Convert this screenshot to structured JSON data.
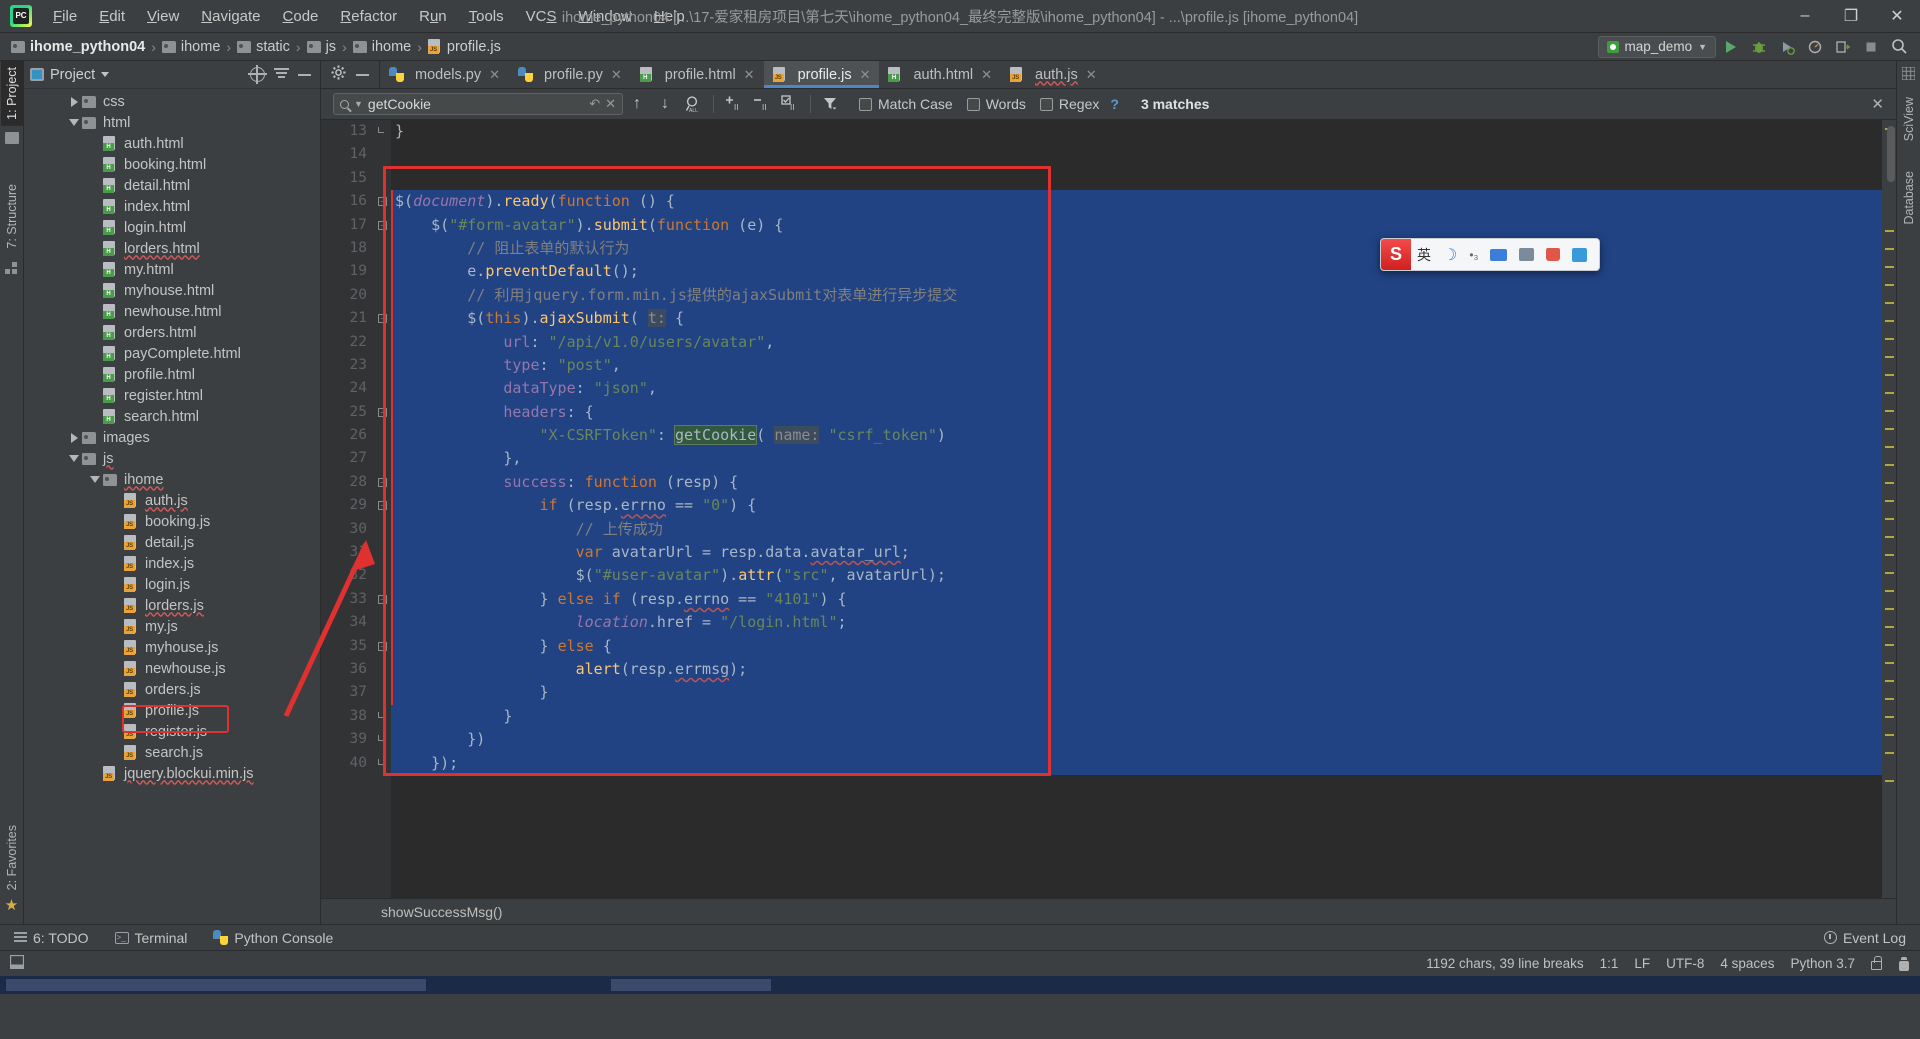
{
  "window": {
    "title": "ihome_python04 [...\\17-爱家租房项目\\第七天\\ihome_python04_最终完整版\\ihome_python04] - ...\\profile.js [ihome_python04]",
    "minimize": "–",
    "maximize": "❐",
    "close": "✕"
  },
  "menu": [
    {
      "label": "File"
    },
    {
      "label": "Edit"
    },
    {
      "label": "View"
    },
    {
      "label": "Navigate"
    },
    {
      "label": "Code"
    },
    {
      "label": "Refactor"
    },
    {
      "label": "Run"
    },
    {
      "label": "Tools"
    },
    {
      "label": "VCS"
    },
    {
      "label": "Window"
    },
    {
      "label": "Help"
    }
  ],
  "breadcrumb": [
    {
      "label": "ihome_python04",
      "icon": "folder-icon",
      "bold": true
    },
    {
      "label": "ihome",
      "icon": "folder-icon",
      "bold": false
    },
    {
      "label": "static",
      "icon": "folder-icon",
      "bold": false
    },
    {
      "label": "js",
      "icon": "folder-icon",
      "bold": false
    },
    {
      "label": "ihome",
      "icon": "folder-icon",
      "bold": false
    },
    {
      "label": "profile.js",
      "icon": "js-file-icon",
      "bold": false
    }
  ],
  "run_config": {
    "name": "map_demo",
    "run_label": "Run",
    "debug_label": "Debug",
    "coverage_label": "Run with Coverage",
    "profile_label": "Profile",
    "stop_label": "Stop",
    "search_label": "Search Everywhere"
  },
  "left_strip": [
    {
      "label": "1: Project",
      "active": true
    },
    {
      "label": "7: Structure",
      "active": false
    },
    {
      "label": "2: Favorites",
      "active": false
    }
  ],
  "right_strip": [
    {
      "label": "SciView"
    },
    {
      "label": "Database"
    }
  ],
  "project_panel": {
    "title": "Project",
    "locate_icon": "target-icon",
    "collapse_icon": "collapse-all-icon",
    "hide_icon": "hide-panel-icon",
    "tree": [
      {
        "label": "css",
        "depth": 2,
        "type": "folder",
        "twisty": "right",
        "squiggle": false
      },
      {
        "label": "html",
        "depth": 2,
        "type": "folder",
        "twisty": "down",
        "squiggle": false
      },
      {
        "label": "auth.html",
        "depth": 3,
        "type": "html",
        "twisty": "none",
        "squiggle": false
      },
      {
        "label": "booking.html",
        "depth": 3,
        "type": "html",
        "twisty": "none",
        "squiggle": false
      },
      {
        "label": "detail.html",
        "depth": 3,
        "type": "html",
        "twisty": "none",
        "squiggle": false
      },
      {
        "label": "index.html",
        "depth": 3,
        "type": "html",
        "twisty": "none",
        "squiggle": false
      },
      {
        "label": "login.html",
        "depth": 3,
        "type": "html",
        "twisty": "none",
        "squiggle": false
      },
      {
        "label": "lorders.html",
        "depth": 3,
        "type": "html",
        "twisty": "none",
        "squiggle": true
      },
      {
        "label": "my.html",
        "depth": 3,
        "type": "html",
        "twisty": "none",
        "squiggle": false
      },
      {
        "label": "myhouse.html",
        "depth": 3,
        "type": "html",
        "twisty": "none",
        "squiggle": false
      },
      {
        "label": "newhouse.html",
        "depth": 3,
        "type": "html",
        "twisty": "none",
        "squiggle": false
      },
      {
        "label": "orders.html",
        "depth": 3,
        "type": "html",
        "twisty": "none",
        "squiggle": false
      },
      {
        "label": "payComplete.html",
        "depth": 3,
        "type": "html",
        "twisty": "none",
        "squiggle": false
      },
      {
        "label": "profile.html",
        "depth": 3,
        "type": "html",
        "twisty": "none",
        "squiggle": false
      },
      {
        "label": "register.html",
        "depth": 3,
        "type": "html",
        "twisty": "none",
        "squiggle": false
      },
      {
        "label": "search.html",
        "depth": 3,
        "type": "html",
        "twisty": "none",
        "squiggle": false
      },
      {
        "label": "images",
        "depth": 2,
        "type": "folder",
        "twisty": "right",
        "squiggle": false
      },
      {
        "label": "js",
        "depth": 2,
        "type": "folder",
        "twisty": "down",
        "squiggle": true
      },
      {
        "label": "ihome",
        "depth": 3,
        "type": "folder",
        "twisty": "down",
        "squiggle": true
      },
      {
        "label": "auth.js",
        "depth": 4,
        "type": "js",
        "twisty": "none",
        "squiggle": true
      },
      {
        "label": "booking.js",
        "depth": 4,
        "type": "js",
        "twisty": "none",
        "squiggle": false
      },
      {
        "label": "detail.js",
        "depth": 4,
        "type": "js",
        "twisty": "none",
        "squiggle": false
      },
      {
        "label": "index.js",
        "depth": 4,
        "type": "js",
        "twisty": "none",
        "squiggle": false
      },
      {
        "label": "login.js",
        "depth": 4,
        "type": "js",
        "twisty": "none",
        "squiggle": false
      },
      {
        "label": "lorders.js",
        "depth": 4,
        "type": "js",
        "twisty": "none",
        "squiggle": true
      },
      {
        "label": "my.js",
        "depth": 4,
        "type": "js",
        "twisty": "none",
        "squiggle": false
      },
      {
        "label": "myhouse.js",
        "depth": 4,
        "type": "js",
        "twisty": "none",
        "squiggle": false
      },
      {
        "label": "newhouse.js",
        "depth": 4,
        "type": "js",
        "twisty": "none",
        "squiggle": false
      },
      {
        "label": "orders.js",
        "depth": 4,
        "type": "js",
        "twisty": "none",
        "squiggle": false
      },
      {
        "label": "profile.js",
        "depth": 4,
        "type": "js",
        "twisty": "none",
        "squiggle": false,
        "highlighted": true
      },
      {
        "label": "register.js",
        "depth": 4,
        "type": "js",
        "twisty": "none",
        "squiggle": false
      },
      {
        "label": "search.js",
        "depth": 4,
        "type": "js",
        "twisty": "none",
        "squiggle": false
      },
      {
        "label": "jquery.blockui.min.js",
        "depth": 3,
        "type": "jsmin",
        "twisty": "none",
        "squiggle": true
      }
    ]
  },
  "editor_tabs": [
    {
      "label": "models.py",
      "icon": "python-file-icon",
      "active": false
    },
    {
      "label": "profile.py",
      "icon": "python-file-icon",
      "active": false
    },
    {
      "label": "profile.html",
      "icon": "html-file-icon",
      "active": false
    },
    {
      "label": "profile.js",
      "icon": "js-file-icon",
      "active": true
    },
    {
      "label": "auth.html",
      "icon": "html-file-icon",
      "active": false
    },
    {
      "label": "auth.js",
      "icon": "js-file-icon",
      "active": false
    }
  ],
  "find_bar": {
    "query": "getCookie",
    "placeholder": "Search",
    "prev_label": "Previous Occurrence",
    "next_label": "Next Occurrence",
    "find_all_label": "Find All",
    "select_all_label": "Select All Occurrences",
    "add_line_label": "Add Line Selection",
    "remove_line_label": "Remove Line Selection",
    "filter_label": "Filter Search Results",
    "match_case": "Match Case",
    "words": "Words",
    "regex": "Regex",
    "help": "?",
    "matches": "3 matches",
    "close": "✕"
  },
  "code": {
    "first_line": 13,
    "lines": [
      {
        "n": 13,
        "fold": "end",
        "segments": [
          {
            "t": "}",
            "c": "par"
          }
        ]
      },
      {
        "n": 14,
        "fold": "",
        "segments": []
      },
      {
        "n": 15,
        "fold": "",
        "segments": []
      },
      {
        "n": 16,
        "fold": "start",
        "segments": [
          {
            "t": "$",
            "c": "par"
          },
          {
            "t": "(",
            "c": "par"
          },
          {
            "t": "document",
            "c": "doc"
          },
          {
            "t": ").",
            "c": "par"
          },
          {
            "t": "ready",
            "c": "fn"
          },
          {
            "t": "(",
            "c": "par"
          },
          {
            "t": "function",
            "c": "kw"
          },
          {
            "t": " () {",
            "c": "par"
          }
        ]
      },
      {
        "n": 17,
        "fold": "start",
        "segments": [
          {
            "t": "    $(",
            "c": "par"
          },
          {
            "t": "\"#form-avatar\"",
            "c": "str"
          },
          {
            "t": ").",
            "c": "par"
          },
          {
            "t": "submit",
            "c": "fn"
          },
          {
            "t": "(",
            "c": "par"
          },
          {
            "t": "function",
            "c": "kw"
          },
          {
            "t": " (e) {",
            "c": "par"
          }
        ]
      },
      {
        "n": 18,
        "fold": "",
        "segments": [
          {
            "t": "        // 阻止表单的默认行为",
            "c": "cmt"
          }
        ]
      },
      {
        "n": 19,
        "fold": "",
        "segments": [
          {
            "t": "        e.",
            "c": "par"
          },
          {
            "t": "preventDefault",
            "c": "fn"
          },
          {
            "t": "();",
            "c": "par"
          }
        ]
      },
      {
        "n": 20,
        "fold": "",
        "segments": [
          {
            "t": "        // 利用jquery.form.min.js提供的ajaxSubmit对表单进行异步提交",
            "c": "cmt"
          }
        ]
      },
      {
        "n": 21,
        "fold": "start",
        "segments": [
          {
            "t": "        $(",
            "c": "par"
          },
          {
            "t": "this",
            "c": "kw"
          },
          {
            "t": ").",
            "c": "par"
          },
          {
            "t": "ajaxSubmit",
            "c": "fn"
          },
          {
            "t": "( ",
            "c": "par"
          },
          {
            "t": "t:",
            "c": "hint"
          },
          {
            "t": " {",
            "c": "par"
          }
        ]
      },
      {
        "n": 22,
        "fold": "",
        "segments": [
          {
            "t": "            url",
            "c": "prop"
          },
          {
            "t": ": ",
            "c": "par"
          },
          {
            "t": "\"/api/v1.0/users/avatar\"",
            "c": "str"
          },
          {
            "t": ",",
            "c": "par"
          }
        ]
      },
      {
        "n": 23,
        "fold": "",
        "segments": [
          {
            "t": "            type",
            "c": "prop"
          },
          {
            "t": ": ",
            "c": "par"
          },
          {
            "t": "\"post\"",
            "c": "str"
          },
          {
            "t": ",",
            "c": "par"
          }
        ]
      },
      {
        "n": 24,
        "fold": "",
        "segments": [
          {
            "t": "            dataType",
            "c": "prop"
          },
          {
            "t": ": ",
            "c": "par"
          },
          {
            "t": "\"json\"",
            "c": "str"
          },
          {
            "t": ",",
            "c": "par"
          }
        ]
      },
      {
        "n": 25,
        "fold": "start",
        "segments": [
          {
            "t": "            headers",
            "c": "prop"
          },
          {
            "t": ": {",
            "c": "par"
          }
        ]
      },
      {
        "n": 26,
        "fold": "",
        "segments": [
          {
            "t": "                ",
            "c": "par"
          },
          {
            "t": "\"X-CSRFToken\"",
            "c": "str"
          },
          {
            "t": ": ",
            "c": "par"
          },
          {
            "t": "getCookie",
            "c": "occ"
          },
          {
            "t": "( ",
            "c": "par"
          },
          {
            "t": "name:",
            "c": "hint"
          },
          {
            "t": " ",
            "c": "par"
          },
          {
            "t": "\"csrf_token\"",
            "c": "str"
          },
          {
            "t": ")",
            "c": "par"
          }
        ]
      },
      {
        "n": 27,
        "fold": "",
        "segments": [
          {
            "t": "            },",
            "c": "par"
          }
        ]
      },
      {
        "n": 28,
        "fold": "start",
        "segments": [
          {
            "t": "            success",
            "c": "prop"
          },
          {
            "t": ": ",
            "c": "par"
          },
          {
            "t": "function",
            "c": "kw"
          },
          {
            "t": " (resp) {",
            "c": "par"
          }
        ]
      },
      {
        "n": 29,
        "fold": "start",
        "segments": [
          {
            "t": "                ",
            "c": "par"
          },
          {
            "t": "if",
            "c": "kw"
          },
          {
            "t": " (resp.",
            "c": "par"
          },
          {
            "t": "errno",
            "c": "err"
          },
          {
            "t": " == ",
            "c": "par"
          },
          {
            "t": "\"0\"",
            "c": "str"
          },
          {
            "t": ") {",
            "c": "par"
          }
        ]
      },
      {
        "n": 30,
        "fold": "",
        "segments": [
          {
            "t": "                    // 上传成功",
            "c": "cmt"
          }
        ]
      },
      {
        "n": 31,
        "fold": "",
        "segments": [
          {
            "t": "                    ",
            "c": "par"
          },
          {
            "t": "var",
            "c": "kw"
          },
          {
            "t": " avatarUrl = resp.data.",
            "c": "par"
          },
          {
            "t": "avatar_url",
            "c": "err"
          },
          {
            "t": ";",
            "c": "par"
          }
        ]
      },
      {
        "n": 32,
        "fold": "",
        "segments": [
          {
            "t": "                    $(",
            "c": "par"
          },
          {
            "t": "\"#user-avatar\"",
            "c": "str"
          },
          {
            "t": ").",
            "c": "par"
          },
          {
            "t": "attr",
            "c": "fn"
          },
          {
            "t": "(",
            "c": "par"
          },
          {
            "t": "\"src\"",
            "c": "str"
          },
          {
            "t": ", avatarUrl);",
            "c": "par"
          }
        ]
      },
      {
        "n": 33,
        "fold": "start",
        "segments": [
          {
            "t": "                } ",
            "c": "par"
          },
          {
            "t": "else if",
            "c": "kw"
          },
          {
            "t": " (resp.",
            "c": "par"
          },
          {
            "t": "errno",
            "c": "err"
          },
          {
            "t": " == ",
            "c": "par"
          },
          {
            "t": "\"4101\"",
            "c": "str"
          },
          {
            "t": ") {",
            "c": "par"
          }
        ]
      },
      {
        "n": 34,
        "fold": "",
        "segments": [
          {
            "t": "                    ",
            "c": "par"
          },
          {
            "t": "location",
            "c": "doc"
          },
          {
            "t": ".href = ",
            "c": "par"
          },
          {
            "t": "\"/login.html\"",
            "c": "str"
          },
          {
            "t": ";",
            "c": "par"
          }
        ]
      },
      {
        "n": 35,
        "fold": "start",
        "segments": [
          {
            "t": "                } ",
            "c": "par"
          },
          {
            "t": "else",
            "c": "kw"
          },
          {
            "t": " {",
            "c": "par"
          }
        ]
      },
      {
        "n": 36,
        "fold": "",
        "segments": [
          {
            "t": "                    ",
            "c": "par"
          },
          {
            "t": "alert",
            "c": "fn"
          },
          {
            "t": "(resp.",
            "c": "par"
          },
          {
            "t": "errmsg",
            "c": "err"
          },
          {
            "t": ");",
            "c": "par"
          }
        ]
      },
      {
        "n": 37,
        "fold": "",
        "segments": [
          {
            "t": "                }",
            "c": "par"
          }
        ]
      },
      {
        "n": 38,
        "fold": "end",
        "segments": [
          {
            "t": "            }",
            "c": "par"
          }
        ]
      },
      {
        "n": 39,
        "fold": "end",
        "segments": [
          {
            "t": "        })",
            "c": "par"
          }
        ]
      },
      {
        "n": 40,
        "fold": "end",
        "segments": [
          {
            "t": "    });",
            "c": "par"
          }
        ]
      }
    ],
    "structure_crumb": "showSuccessMsg()"
  },
  "bottom_bar": [
    {
      "label": "6: TODO",
      "icon": "todo-icon"
    },
    {
      "label": "Terminal",
      "icon": "terminal-icon"
    },
    {
      "label": "Python Console",
      "icon": "python-icon"
    }
  ],
  "event_log": "Event Log",
  "status_bar": {
    "chars": "1192 chars, 39 line breaks",
    "caret": "1:1",
    "line_sep": "LF",
    "encoding": "UTF-8",
    "indent": "4 spaces",
    "interpreter": "Python 3.7",
    "lock_icon": "lock-icon",
    "inspection_icon": "inspection-icon"
  },
  "ime_toolbar": {
    "logo": "S",
    "mode": "英",
    "moon": "☽",
    "dots": "•₃",
    "keyboard": "keyboard-icon",
    "box": "toolbox-icon",
    "bag": "bag-icon",
    "wrench": "wrench-icon"
  },
  "colors": {
    "accent": "#4a88c7",
    "annotation_red": "#e03131",
    "selection_blue": "#214283",
    "panel_bg": "#3c3f41",
    "editor_bg": "#2b2b2b"
  }
}
